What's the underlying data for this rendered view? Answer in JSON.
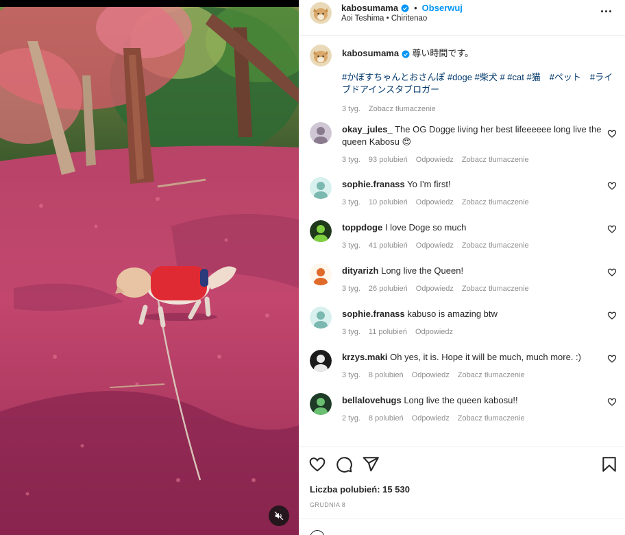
{
  "post": {
    "author": "kabosumama",
    "follow_label": "Obserwuj",
    "location": "Aoi Teshima • Chiritenao",
    "caption_text": "尊い時間です。",
    "hashtags": "#かぼすちゃんとおさんぽ #doge #柴犬 # #cat #猫　#ペット　#ライブドアインスタブロガー",
    "caption_time": "3 tyg.",
    "translate_label": "Zobacz tłumaczenie",
    "likes_text": "Liczba polubień: 15 530",
    "date": "GRUDNIA 8"
  },
  "comments": [
    {
      "user": "okay_jules_",
      "text": "The OG Dogge living her best lifeeeeee long live the queen Kabosu 😍",
      "time": "3 tyg.",
      "likes": "93 polubień",
      "reply": "Odpowiedz",
      "translate": "Zobacz tłumaczenie"
    },
    {
      "user": "sophie.franass",
      "text": "Yo I'm first!",
      "time": "3 tyg.",
      "likes": "10 polubień",
      "reply": "Odpowiedz",
      "translate": "Zobacz tłumaczenie"
    },
    {
      "user": "toppdoge",
      "text": "I love Doge so much",
      "time": "3 tyg.",
      "likes": "41 polubień",
      "reply": "Odpowiedz",
      "translate": "Zobacz tłumaczenie"
    },
    {
      "user": "dityarizh",
      "text": "Long live the Queen!",
      "time": "3 tyg.",
      "likes": "26 polubień",
      "reply": "Odpowiedz",
      "translate": "Zobacz tłumaczenie"
    },
    {
      "user": "sophie.franass",
      "text": "kabuso is amazing btw",
      "time": "3 tyg.",
      "likes": "11 polubień",
      "reply": "Odpowiedz",
      "translate": ""
    },
    {
      "user": "krzys.maki",
      "text": "Oh yes, it is. Hope it will be much, much more. :)",
      "time": "3 tyg.",
      "likes": "8 polubień",
      "reply": "Odpowiedz",
      "translate": "Zobacz tłumaczenie"
    },
    {
      "user": "bellalovehugs",
      "text": "Long live the queen kabosu!!",
      "time": "2 tyg.",
      "likes": "8 polubień",
      "reply": "Odpowiedz",
      "translate": "Zobacz tłumaczenie"
    }
  ],
  "icons": {
    "verified": "verified-badge-icon",
    "more": "more-options-icon",
    "like": "heart-icon",
    "comment": "comment-icon",
    "share": "send-icon",
    "save": "bookmark-icon",
    "mute": "muted-speaker-icon"
  },
  "colors": {
    "accent": "#0095f6",
    "hashtag": "#00376b",
    "muted_text": "#8e8e8e"
  }
}
